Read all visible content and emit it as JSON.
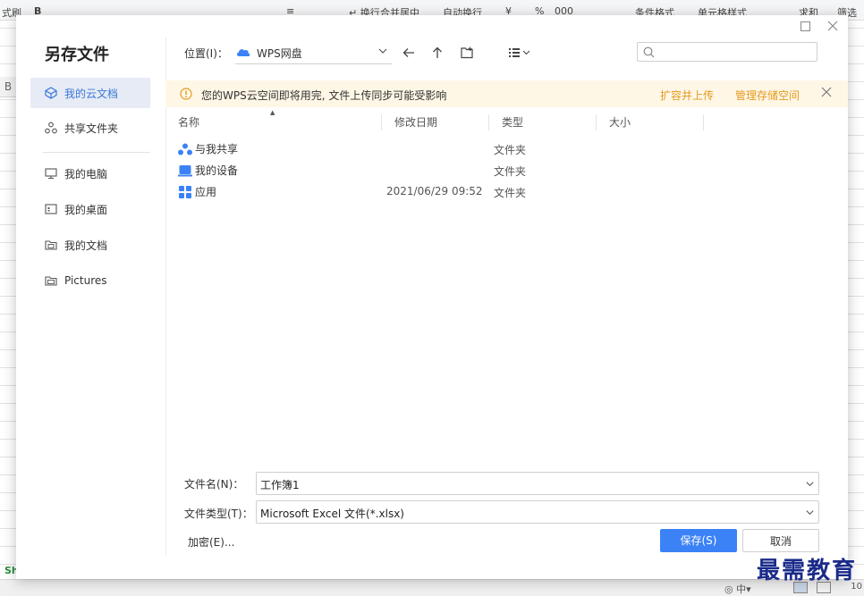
{
  "background": {
    "toolbar_items": [
      "式刷",
      "B",
      "≡",
      "↵ 换行",
      "合并居中",
      "自动换行",
      "¥",
      "%",
      "000",
      "条件格式",
      "单元格样式",
      "求和",
      "筛选"
    ],
    "column_header": "B",
    "sheet_tab": "Sh",
    "zoom": "10",
    "watermark": "最需教育"
  },
  "dialog": {
    "title": "另存文件",
    "sidebar": {
      "items": [
        {
          "label": "我的云文档",
          "icon": "cloud-doc-icon",
          "active": true
        },
        {
          "label": "共享文件夹",
          "icon": "share-icon",
          "active": false
        },
        {
          "label": "我的电脑",
          "icon": "computer-icon",
          "active": false
        },
        {
          "label": "我的桌面",
          "icon": "desktop-icon",
          "active": false
        },
        {
          "label": "我的文档",
          "icon": "documents-icon",
          "active": false
        },
        {
          "label": "Pictures",
          "icon": "folder-icon",
          "active": false
        }
      ]
    },
    "location": {
      "label": "位置(I)：",
      "value": "WPS网盘"
    },
    "search": {
      "placeholder": ""
    },
    "warning": {
      "text": "您的WPS云空间即将用完, 文件上传同步可能受影响",
      "link_expand": "扩容并上传",
      "link_manage": "管理存储空间"
    },
    "columns": {
      "name": "名称",
      "date": "修改日期",
      "type": "类型",
      "size": "大小"
    },
    "files": [
      {
        "name": "与我共享",
        "date": "",
        "type": "文件夹",
        "icon": "shared-with-me-icon"
      },
      {
        "name": "我的设备",
        "date": "",
        "type": "文件夹",
        "icon": "device-icon"
      },
      {
        "name": "应用",
        "date": "2021/06/29 09:52",
        "type": "文件夹",
        "icon": "apps-icon"
      }
    ],
    "filename": {
      "label": "文件名(N)：",
      "value": "工作簿1"
    },
    "filetype": {
      "label": "文件类型(T)：",
      "value": "Microsoft Excel 文件(*.xlsx)"
    },
    "encrypt_label": "加密(E)...",
    "save_label": "保存(S)",
    "cancel_label": "取消",
    "colors": {
      "accent": "#3b82f6",
      "warning_bg": "#fff7e6",
      "warning_link": "#e49a20",
      "sidebar_active": "#e6ebf5"
    }
  }
}
